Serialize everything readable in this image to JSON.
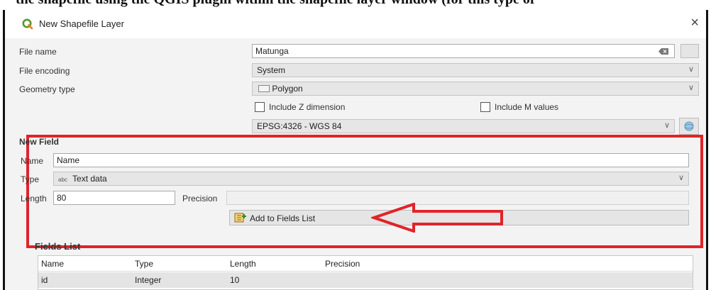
{
  "window": {
    "title": "New Shapefile Layer",
    "close": "×"
  },
  "form": {
    "file_name_label": "File name",
    "file_name_value": "Matunga",
    "file_encoding_label": "File encoding",
    "file_encoding_value": "System",
    "geometry_type_label": "Geometry type",
    "geometry_type_value": "Polygon",
    "include_z_label": "Include Z dimension",
    "include_m_label": "Include M values",
    "crs_value": "EPSG:4326 - WGS 84"
  },
  "new_field": {
    "title": "New Field",
    "name_label": "Name",
    "name_value": "Name",
    "type_label": "Type",
    "type_prefix": "abc",
    "type_value": "Text data",
    "length_label": "Length",
    "length_value": "80",
    "precision_label": "Precision",
    "add_button_label": "Add to Fields List"
  },
  "fields_list": {
    "title": "Fields List",
    "columns": [
      "Name",
      "Type",
      "Length",
      "Precision"
    ],
    "rows": [
      {
        "name": "id",
        "type": "Integer",
        "length": "10",
        "precision": ""
      }
    ]
  },
  "colors": {
    "highlight_red": "#e0242a",
    "qgis_green": "#589632"
  },
  "icons": [
    "qgis-logo-icon",
    "close-icon",
    "clear-text-icon",
    "browse-icon",
    "polygon-icon",
    "chevron-down-icon",
    "crs-select-icon",
    "add-fields-icon",
    "red-arrow-annotation"
  ]
}
